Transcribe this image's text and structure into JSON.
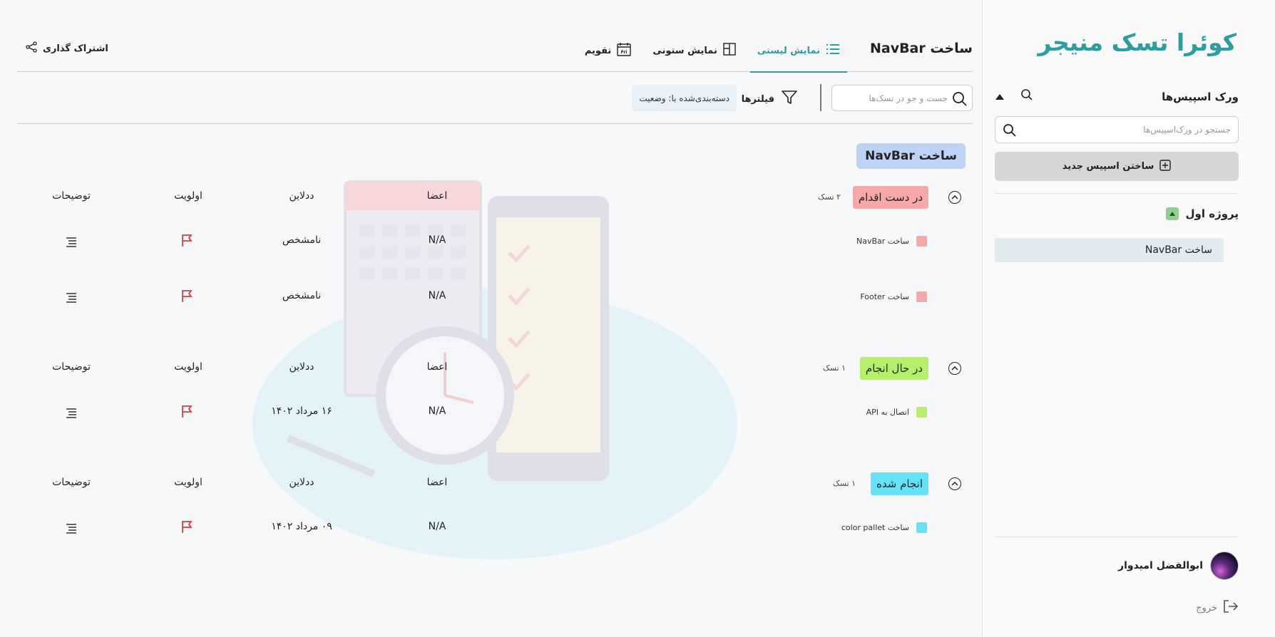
{
  "sidebar": {
    "brand": "کوئرا تسک منیجر",
    "workspaces_title": "ورک اسپیس‌ها",
    "search_placeholder": "جستجو در ورک‌اسپیس‌ها",
    "new_space_label": "ساختن اسپیس جدید",
    "project_label": "پروژه اول",
    "task_label": "ساخت NavBar",
    "user_name": "ابوالفضل امیدوار",
    "logout_label": "خروج"
  },
  "header": {
    "page_title": "ساخت NavBar",
    "tabs": [
      {
        "label": "نمایش لیستی",
        "active": true
      },
      {
        "label": "نمایش ستونی",
        "active": false
      },
      {
        "label": "تقویم",
        "active": false
      }
    ],
    "calendar_icon_text": "Fri",
    "share_label": "اشتراک گذاری"
  },
  "toolbar": {
    "search_placeholder": "جست و جو در تسک‌ها",
    "filters_label": "فیلترها",
    "group_by_label": "دسته‌بندی‌شده با: وضعیت"
  },
  "list": {
    "title": "ساخت NavBar",
    "columns": {
      "members": "اعضا",
      "deadline": "ددلاین",
      "priority": "اولویت",
      "description": "توضیحات"
    },
    "groups": [
      {
        "status": "در دست اقدام",
        "count": "۲ تسک",
        "color": "#f7a8a8",
        "tasks": [
          {
            "name": "ساخت NavBar",
            "members": "N/A",
            "deadline": "نامشخص"
          },
          {
            "name": "ساخت Footer",
            "members": "N/A",
            "deadline": "نامشخص"
          }
        ]
      },
      {
        "status": "در حال انجام",
        "count": "۱ تسک",
        "color": "#b6ef6a",
        "tasks": [
          {
            "name": "اتصال به API",
            "members": "N/A",
            "deadline": "۱۶ مرداد ۱۴۰۲"
          }
        ]
      },
      {
        "status": "انجام شده",
        "count": "۱ تسک",
        "color": "#63e3f5",
        "tasks": [
          {
            "name": "ساخت color pallet",
            "members": "N/A",
            "deadline": "۰۹ مرداد ۱۴۰۲"
          }
        ]
      }
    ]
  },
  "colors": {
    "accent": "#2b9ea0",
    "priority_flag": "#e03b3b"
  }
}
